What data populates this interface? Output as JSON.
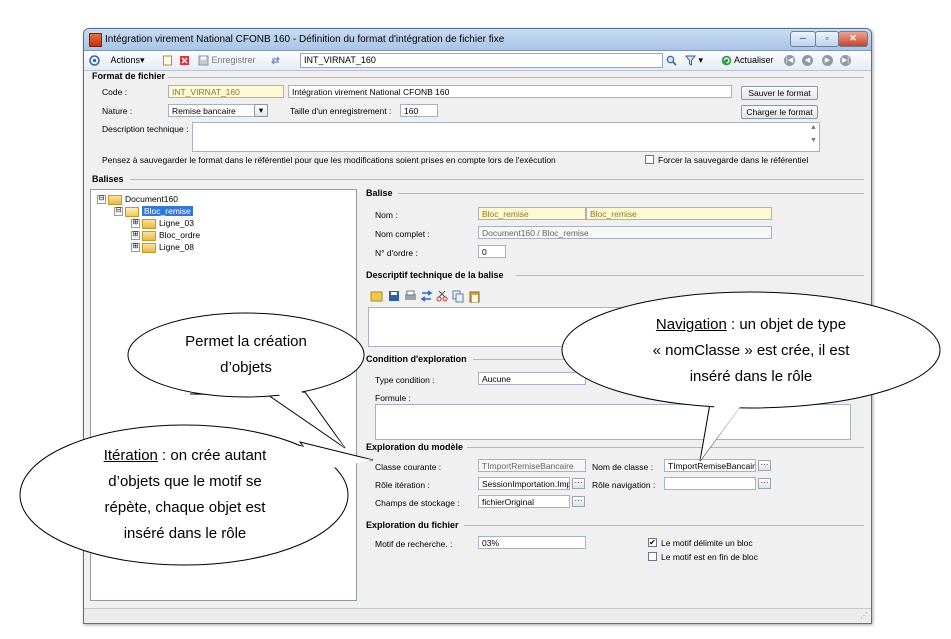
{
  "window": {
    "title": "Intégration virement National CFONB 160 -  Définition du format d'intégration de fichier fixe",
    "controls": [
      "─",
      "▫",
      "✕"
    ]
  },
  "toolbar": {
    "actions_label": "Actions",
    "save_label": "Enregistrer",
    "search_value": "INT_VIRNAT_160",
    "refresh_label": "Actualiser"
  },
  "format": {
    "section_title": "Format de fichier",
    "code_label": "Code :",
    "code_value": "INT_VIRNAT_160",
    "name_value": "Intégration virement National CFONB 160",
    "nature_label": "Nature :",
    "nature_value": "Remise bancaire",
    "size_label": "Taille d'un enregistrement :",
    "size_value": "160",
    "save_button": "Sauver le format",
    "load_button": "Charger le format",
    "desc_label": "Description technique :",
    "desc_value": "",
    "note": "Pensez à sauvegarder le format dans le référentiel pour que les modifications soient prises en compte lors de l'exécution",
    "force_label": "Forcer la sauvegarde dans le référentiel",
    "force_checked": false
  },
  "balises": {
    "section_title": "Balises",
    "tree": [
      {
        "label": "Document160",
        "expander": "⊟"
      },
      {
        "label": "Bloc_remise",
        "expander": "⊟"
      },
      {
        "label": "Ligne_03",
        "expander": "⊞"
      },
      {
        "label": "Bloc_ordre",
        "expander": "⊞"
      },
      {
        "label": "Ligne_08",
        "expander": "⊞"
      }
    ]
  },
  "balise": {
    "section_title": "Balise",
    "nom_label": "Nom :",
    "nom_value": "Bloc_remise",
    "nom_value2": "Bloc_remise",
    "nom_complet_label": "Nom complet :",
    "nom_complet_value": "Document160 / Bloc_remise",
    "ordre_label": "N° d'ordre :",
    "ordre_value": "0"
  },
  "descriptif": {
    "section_title": "Descriptif technique de la balise"
  },
  "condition": {
    "section_title": "Condition d'exploration",
    "type_label": "Type condition :",
    "type_value": "Aucune",
    "formule_label": "Formule :"
  },
  "modele": {
    "section_title": "Exploration du modèle",
    "classe_label": "Classe courante :",
    "classe_value": "TImportRemiseBancaire",
    "nom_classe_label": "Nom de classe :",
    "nom_classe_value": "TImportRemiseBancair",
    "role_iter_label": "Rôle itération :",
    "role_iter_value": "SessionImportation.Imp",
    "role_nav_label": "Rôle navigation :",
    "role_nav_value": "",
    "champs_label": "Champs de stockage :",
    "champs_value": "fichierOriginal"
  },
  "fichier": {
    "section_title": "Exploration du fichier",
    "motif_label": "Motif de recherche. :",
    "motif_value": "03%",
    "delimite_label": "Le motif délimite un bloc",
    "delimite_checked": true,
    "fin_label": "Le motif est en fin de bloc",
    "fin_checked": false
  },
  "callouts": {
    "creation": {
      "line1": "Permet la création",
      "line2": "d’objets"
    },
    "navigation": {
      "term": "Navigation",
      "rest1": " : un objet de type",
      "line2": "« nomClasse » est crée, il est",
      "line3": "inséré dans le rôle"
    },
    "iteration": {
      "term": "Itération",
      "rest1": " : on crée autant",
      "line2": "d’objets que le motif se",
      "line3": "répète, chaque objet est",
      "line4": "inséré dans le rôle"
    }
  },
  "ellipsis": "···",
  "colors": {
    "titlebar": "#bcd2ee",
    "selection": "#3377d6",
    "yellow_field": "#fff9d6"
  }
}
